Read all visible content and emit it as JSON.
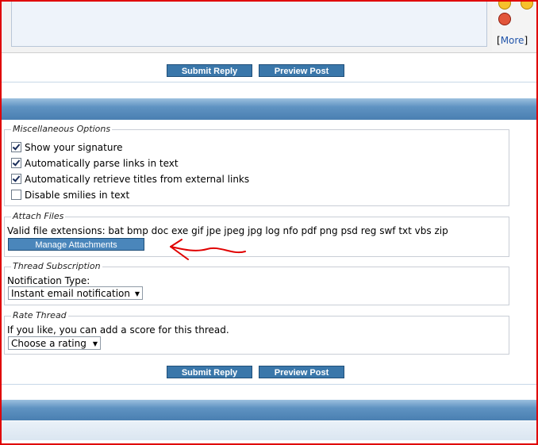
{
  "top": {
    "more_open": "[",
    "more_label": "More",
    "more_close": "]"
  },
  "buttons": {
    "submit": "Submit Reply",
    "preview": "Preview Post"
  },
  "misc": {
    "legend": "Miscellaneous Options",
    "options": [
      {
        "label": "Show your signature",
        "checked": true
      },
      {
        "label": "Automatically parse links in text",
        "checked": true
      },
      {
        "label": "Automatically retrieve titles from external links",
        "checked": true
      },
      {
        "label": "Disable smilies in text",
        "checked": false
      }
    ]
  },
  "attach": {
    "legend": "Attach Files",
    "extensions": "Valid file extensions: bat bmp doc exe gif jpe jpeg jpg log nfo pdf png psd reg swf txt vbs zip",
    "manage": "Manage Attachments"
  },
  "subscription": {
    "legend": "Thread Subscription",
    "label": "Notification Type:",
    "selected": "Instant email notification"
  },
  "rate": {
    "legend": "Rate Thread",
    "prompt": "If you like, you can add a score for this thread.",
    "selected": "Choose a rating"
  },
  "colors": {
    "accent": "#3a77aa",
    "frame": "#e00000",
    "annotation": "#e00000"
  },
  "icons": [
    "smiley-icon",
    "devil-smiley-icon",
    "checkbox-icon",
    "dropdown-arrow-icon"
  ]
}
